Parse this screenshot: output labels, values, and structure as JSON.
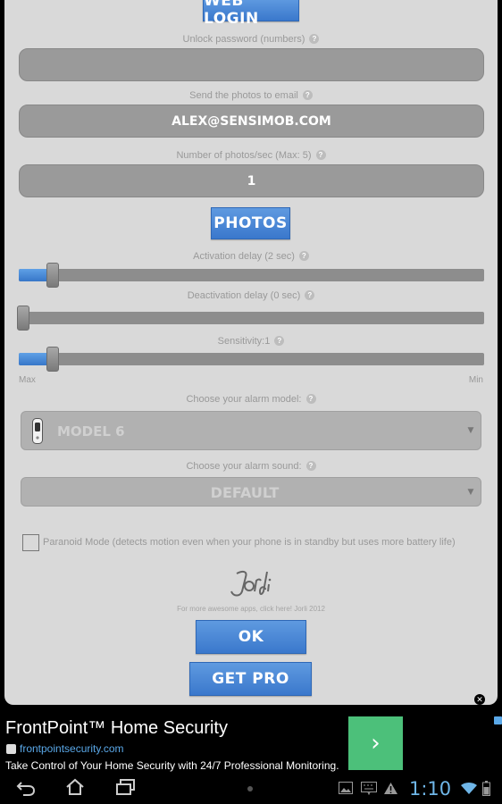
{
  "panel": {
    "web_login_label": "WEB LOGIN",
    "unlock_password": {
      "label": "Unlock password (numbers)",
      "value": ""
    },
    "send_email": {
      "label": "Send the photos to email",
      "value": "ALEX@SENSIMOB.COM"
    },
    "photos_per_sec": {
      "label": "Number of photos/sec (Max: 5)",
      "value": "1"
    },
    "photos_button": "PHOTOS",
    "activation_delay": {
      "label": "Activation delay (2 sec)",
      "level": 0.07
    },
    "deactivation_delay": {
      "label": "Deactivation delay (0 sec)",
      "level": 0
    },
    "sensitivity": {
      "label": "Sensitivity:1",
      "level": 0.07,
      "min_label": "Min",
      "max_label": "Max"
    },
    "alarm_model": {
      "label": "Choose your alarm model:",
      "value": "MODEL 6"
    },
    "alarm_sound": {
      "label": "Choose your alarm sound:",
      "value": "DEFAULT"
    },
    "paranoid": {
      "label": "Paranoid Mode (detects motion even when your phone is in standby but uses more battery life)",
      "checked": false
    },
    "logo_text": "Jordi",
    "credits": "For more awesome apps, click here! Jorli 2012",
    "ok_button": "OK",
    "get_pro_button": "GET PRO",
    "help_mark": "?"
  },
  "ad": {
    "title": "FrontPoint™ Home Security",
    "url": "frontpointsecurity.com",
    "description": "Take Control of Your Home Security with 24/7 Professional Monitoring.",
    "cta_color": "#4cc07a"
  },
  "status": {
    "time": "1:10"
  },
  "colors": {
    "accent": "#4a88d8",
    "panel": "#d9d9d9"
  }
}
